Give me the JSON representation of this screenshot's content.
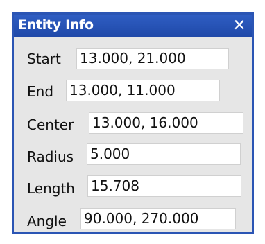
{
  "window": {
    "title": "Entity Info",
    "close_label": "✕"
  },
  "fields": {
    "start": {
      "label": "Start",
      "value": "13.000, 21.000"
    },
    "end": {
      "label": "End",
      "value": "13.000, 11.000"
    },
    "center": {
      "label": "Center",
      "value": "13.000, 16.000"
    },
    "radius": {
      "label": "Radius",
      "value": "5.000"
    },
    "length": {
      "label": "Length",
      "value": "15.708"
    },
    "angle": {
      "label": "Angle",
      "value": "90.000, 270.000"
    }
  },
  "colors": {
    "title_bar": "#2b55b4",
    "panel_bg": "#e6e6e6",
    "field_bg": "#ffffff"
  }
}
